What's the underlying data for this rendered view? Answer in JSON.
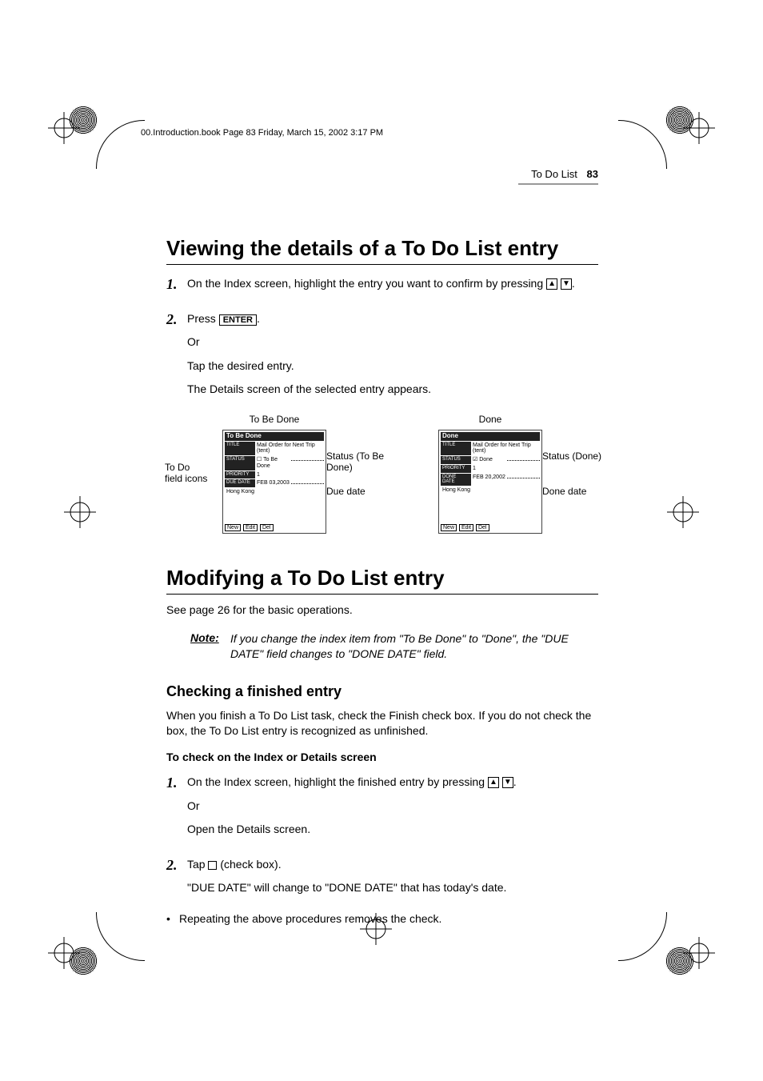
{
  "print_header": "00.Introduction.book  Page 83  Friday, March 15, 2002  3:17 PM",
  "running_head": {
    "title": "To Do List",
    "page": "83"
  },
  "section1": {
    "title": "Viewing the details of a To Do List entry",
    "step1_num": "1.",
    "step1_text": "On the Index screen, highlight the entry you want to confirm by pressing ",
    "step2_num": "2.",
    "step2_a": "Press ",
    "step2_key": "ENTER",
    "step2_b": "Or",
    "step2_c": "Tap the desired entry.",
    "step2_d": "The Details screen of the selected entry appears."
  },
  "figures": {
    "left_caption": "To Be Done",
    "right_caption": "Done",
    "left_side": "To Do field icons",
    "left_r1": "Status (To Be Done)",
    "left_r2": "Due date",
    "right_r1": "Status (Done)",
    "right_r2": "Done date",
    "box_left": {
      "titlebar": "To Be Done",
      "f_title_lbl": "TITLE",
      "f_title_val": "Mail Order for Next Trip (tent)",
      "f_status_lbl": "STATUS",
      "f_status_val": "☐ To Be Done",
      "f_prio_lbl": "PRIORITY",
      "f_prio_val": "1",
      "f_due_lbl": "DUE DATE",
      "f_due_val": "FEB 03,2003",
      "f_note": "Hong Kong",
      "btn1": "New",
      "btn2": "Edit",
      "btn3": "Del"
    },
    "box_right": {
      "titlebar": "Done",
      "f_title_lbl": "TITLE",
      "f_title_val": "Mail Order for Next Trip (tent)",
      "f_status_lbl": "STATUS",
      "f_status_val": "☑ Done",
      "f_prio_lbl": "PRIORITY",
      "f_prio_val": "1",
      "f_done_lbl": "DONE DATE",
      "f_done_val": "FEB 20,2002",
      "f_note": "Hong Kong",
      "btn1": "New",
      "btn2": "Edit",
      "btn3": "Del"
    }
  },
  "section2": {
    "title": "Modifying a To Do List entry",
    "intro": "See page 26 for the basic operations.",
    "note_label": "Note:",
    "note_body": "If you change the index item from \"To Be Done\" to \"Done\", the \"DUE DATE\" field changes to \"DONE DATE\" field.",
    "sub_title": "Checking a finished entry",
    "sub_intro": "When you finish a To Do List task, check the Finish check box. If you do not check the box, the To Do List entry is recognized as unfinished.",
    "subsub_title": "To check on the Index or Details screen",
    "s1_num": "1.",
    "s1_a": "On the Index screen, highlight the finished entry by pressing ",
    "s1_b": "Or",
    "s1_c": "Open the Details screen.",
    "s2_num": "2.",
    "s2_a": "Tap ",
    "s2_b": " (check box).",
    "s2_c": "\"DUE DATE\" will change to \"DONE DATE\" that has today's date.",
    "bullet": "Repeating the above procedures removes the check."
  }
}
